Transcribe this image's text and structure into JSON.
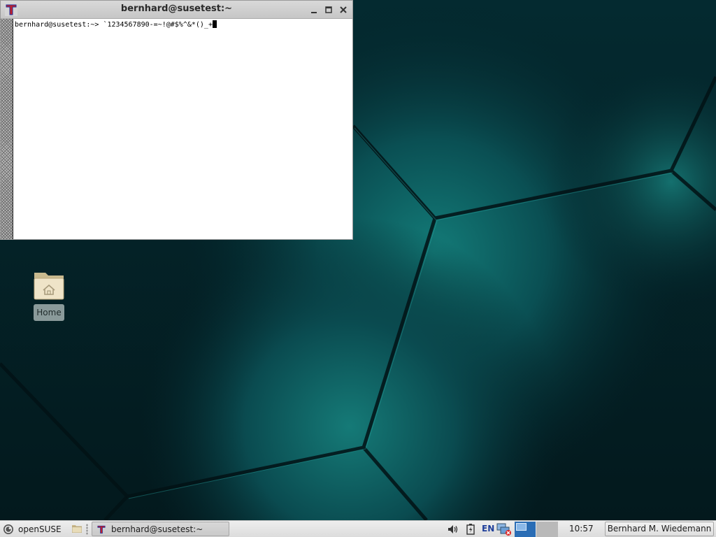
{
  "terminal": {
    "title": "bernhard@susetest:~",
    "prompt": "bernhard@susetest:~> ",
    "command": "`1234567890-=~!@#$%^&*()_+"
  },
  "desktop": {
    "home_label": "Home"
  },
  "taskbar": {
    "start_label": "openSUSE",
    "task_label": "bernhard@susetest:~",
    "language": "EN",
    "clock": "10:57",
    "user_label": "Bernhard M. Wiedemann"
  },
  "icons": {
    "app": "terminal-icon",
    "minimize": "minimize-icon",
    "maximize": "maximize-icon",
    "close": "close-icon",
    "start": "opensuse-logo-icon",
    "file_manager": "folder-icon",
    "volume": "speaker-icon",
    "battery": "battery-icon",
    "network": "network-disconnected-icon",
    "home": "home-folder-icon"
  },
  "colors": {
    "accent": "#2a6db5",
    "desktop_bg": "#062a2e",
    "teal_glow": "#1b8a86"
  }
}
